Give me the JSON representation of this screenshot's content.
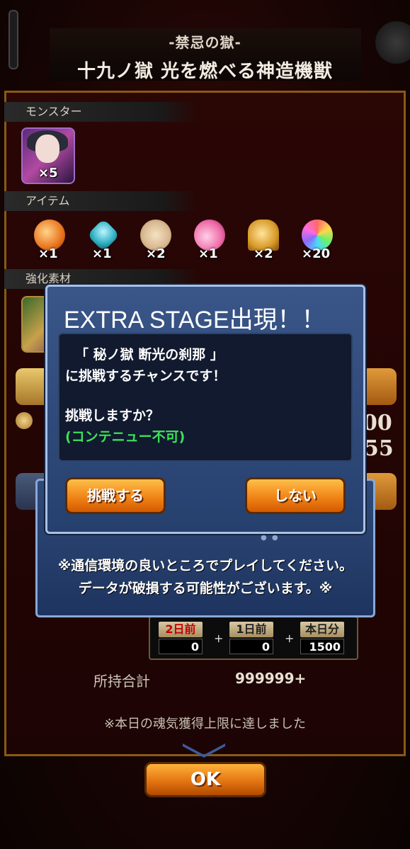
{
  "header": {
    "subtitle": "-禁忌の獄-",
    "title": "十九ノ獄 光を燃べる神造機獣"
  },
  "sections": {
    "monster_label": "モンスター",
    "item_label": "アイテム",
    "enhance_label": "強化素材"
  },
  "monster": {
    "qty": "×5"
  },
  "items": [
    {
      "icon": "orange-gem-icon",
      "qty": "×1",
      "color": "#e8731c"
    },
    {
      "icon": "blue-crystal-icon",
      "qty": "×1",
      "color": "#36b6c8"
    },
    {
      "icon": "coin-icon",
      "qty": "×2",
      "color": "#d8b890"
    },
    {
      "icon": "potion-icon",
      "qty": "×1",
      "color": "#ee6aa8"
    },
    {
      "icon": "bell-icon",
      "qty": "×2",
      "color": "#d89a2a"
    },
    {
      "icon": "rainbow-orb-icon",
      "qty": "×20",
      "color": "#b07ad8"
    }
  ],
  "background_partial": {
    "num_a": "00",
    "num_b": "55"
  },
  "soul": {
    "cols": [
      {
        "label": "2日前",
        "value": "0"
      },
      {
        "label": "1日前",
        "value": "0"
      },
      {
        "label": "本日分",
        "value": "1500"
      }
    ],
    "plus": "+",
    "total_label": "所持合計",
    "total_value": "999999+",
    "limit_note": "※本日の魂気獲得上限に達しました"
  },
  "ok_label": "OK",
  "notice": {
    "line1": "※通信環境の良いところでプレイしてください。",
    "line2": "データが破損する可能性がございます。※"
  },
  "dialog": {
    "title": "EXTRA STAGE出現！！",
    "line1": "「 秘ノ獄 断光の刹那 」",
    "line2": "に挑戦するチャンスです！",
    "line3": "挑戦しますか？",
    "line4": "(コンテニュー不可)",
    "accept_label": "挑戦する",
    "decline_label": "しない"
  },
  "colors": {
    "accent_orange": "#f08418",
    "panel_red": "#2a0605",
    "dialog_blue": "#2f4a78",
    "green_note": "#3ee05a"
  }
}
